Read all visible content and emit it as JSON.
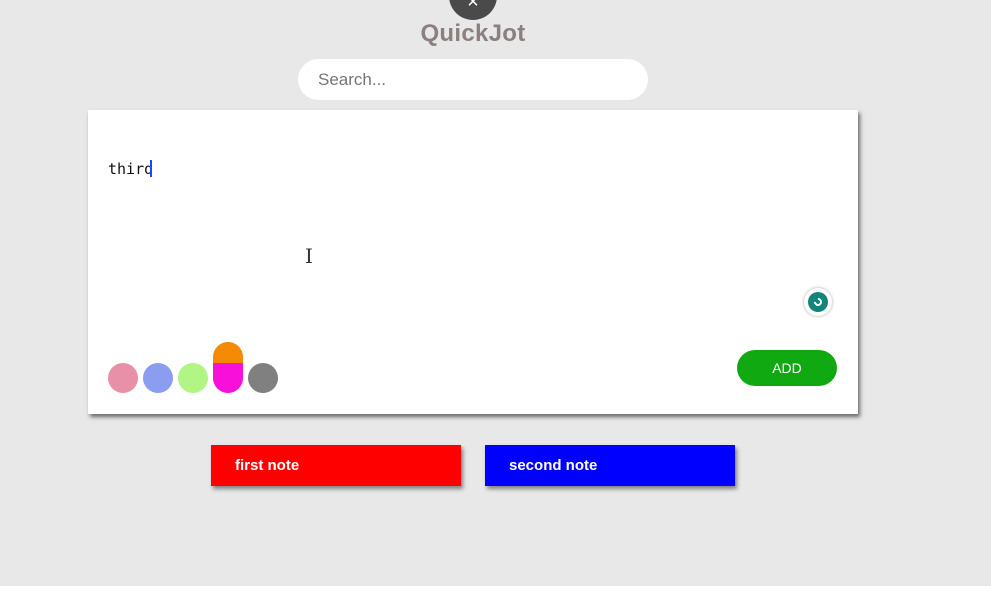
{
  "app": {
    "title": "QuickJot",
    "close_glyph": "×"
  },
  "search": {
    "placeholder": "Search...",
    "value": ""
  },
  "editor": {
    "text": "third",
    "text_cursor_glyph": "I",
    "add_label": "ADD",
    "add_color": "#11a911",
    "grammar_icon": "grammar-check-icon",
    "swatches": [
      {
        "name": "pink",
        "color": "#e890a8"
      },
      {
        "name": "blue",
        "color": "#8b9df0"
      },
      {
        "name": "green",
        "color": "#b1f585"
      },
      {
        "name": "orange-magenta",
        "color": "#f58a07",
        "color2": "#f80fd9",
        "selected": true
      },
      {
        "name": "gray",
        "color": "#808080"
      }
    ]
  },
  "notes": [
    {
      "title": "first note",
      "color": "#ff0000"
    },
    {
      "title": "second note",
      "color": "#0000ff"
    }
  ]
}
